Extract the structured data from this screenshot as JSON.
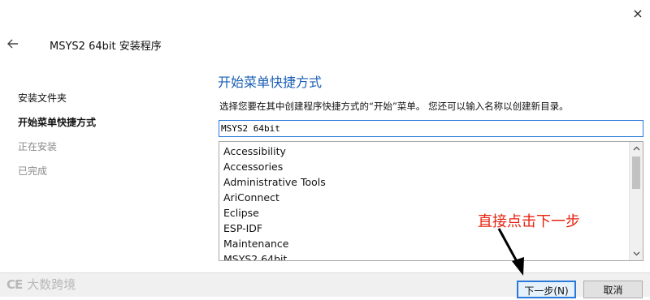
{
  "window": {
    "close_icon": "×",
    "back_icon": "arrow-left",
    "title": "MSYS2 64bit 安装程序"
  },
  "steps": [
    {
      "label": "安装文件夹",
      "state": "done"
    },
    {
      "label": "开始菜单快捷方式",
      "state": "active"
    },
    {
      "label": "正在安装",
      "state": "pending"
    },
    {
      "label": "已完成",
      "state": "pending"
    }
  ],
  "main": {
    "section_title": "开始菜单快捷方式",
    "instruction": "选择您要在其中创建程序快捷方式的“开始”菜单。 您还可以输入名称以创建新目录。",
    "folder_input_value": "MSYS2 64bit",
    "folder_list": [
      "Accessibility",
      "Accessories",
      "Administrative Tools",
      "AriConnect",
      "Eclipse",
      "ESP-IDF",
      "Maintenance",
      "MSYS2 64bit"
    ]
  },
  "footer": {
    "next_button": "下一步(N)",
    "cancel_button": "取消"
  },
  "annotation": {
    "text": "直接点击下一步",
    "color": "#e8220f"
  },
  "watermark": {
    "logo": "CE",
    "text": "大数跨境"
  },
  "colors": {
    "accent": "#2b79d8",
    "title_blue": "#1a5fb4"
  }
}
